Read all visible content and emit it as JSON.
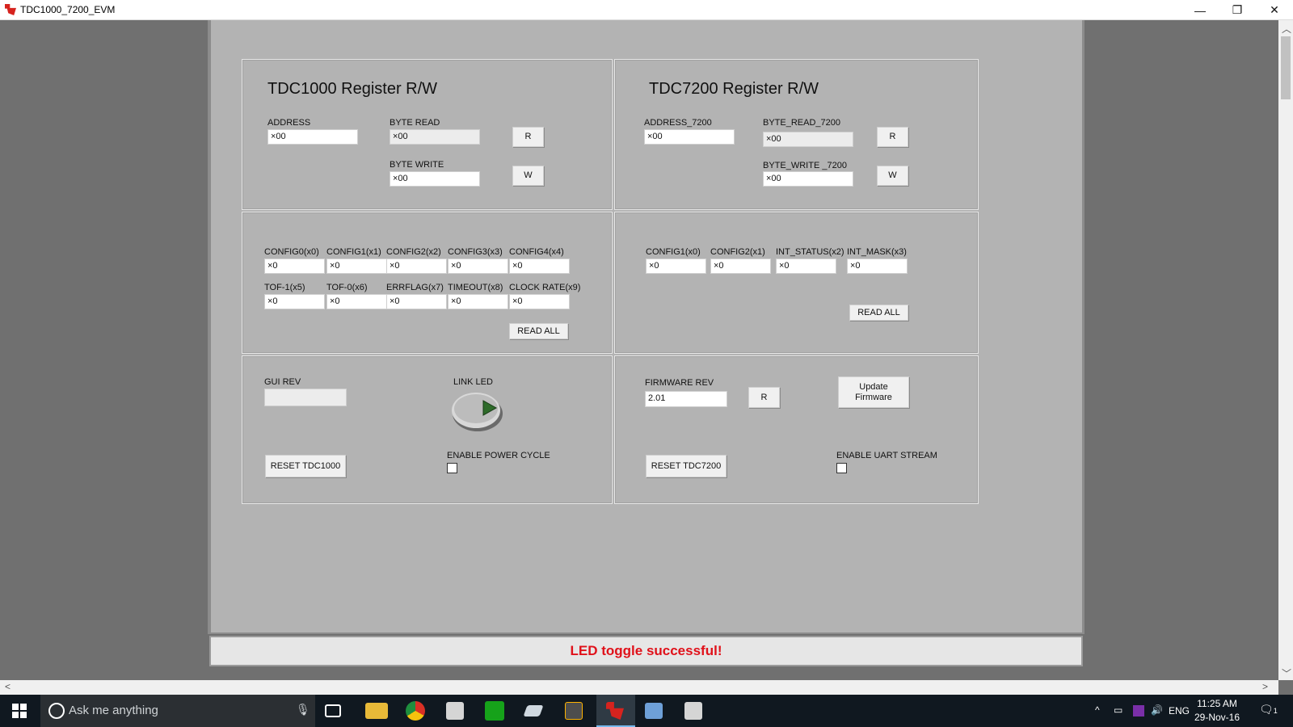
{
  "window": {
    "title": "TDC1000_7200_EVM",
    "minimize": "—",
    "restore": "❐",
    "close": "✕"
  },
  "tdc1000_rw": {
    "title": "TDC1000 Register R/W",
    "address_label": "ADDRESS",
    "address_value": "×00",
    "byte_read_label": "BYTE READ",
    "byte_read_value": "×00",
    "byte_write_label": "BYTE WRITE",
    "byte_write_value": "×00",
    "read_button": "R",
    "write_button": "W"
  },
  "tdc7200_rw": {
    "title": "TDC7200 Register R/W",
    "address_label": "ADDRESS_7200",
    "address_value": "×00",
    "byte_read_label": "BYTE_READ_7200",
    "byte_read_value": "×00",
    "byte_write_label": "BYTE_WRITE _7200",
    "byte_write_value": "×00",
    "read_button": "R",
    "write_button": "W"
  },
  "tdc1000_regs": {
    "row1": [
      {
        "label": "CONFIG0(x0)",
        "value": "×0"
      },
      {
        "label": "CONFIG1(x1)",
        "value": "×0"
      },
      {
        "label": "CONFIG2(x2)",
        "value": "×0"
      },
      {
        "label": "CONFIG3(x3)",
        "value": "×0"
      },
      {
        "label": "CONFIG4(x4)",
        "value": "×0"
      }
    ],
    "row2": [
      {
        "label": "TOF-1(x5)",
        "value": "×0"
      },
      {
        "label": "TOF-0(x6)",
        "value": "×0"
      },
      {
        "label": "ERRFLAG(x7)",
        "value": "×0"
      },
      {
        "label": "TIMEOUT(x8)",
        "value": "×0"
      },
      {
        "label": "CLOCK RATE(x9)",
        "value": "×0"
      }
    ],
    "read_all": "READ ALL"
  },
  "tdc7200_regs": {
    "row1": [
      {
        "label": "CONFIG1(x0)",
        "value": "×0"
      },
      {
        "label": "CONFIG2(x1)",
        "value": "×0"
      },
      {
        "label": "INT_STATUS(x2)",
        "value": "×0"
      },
      {
        "label": "INT_MASK(x3)",
        "value": "×0"
      }
    ],
    "read_all": "READ ALL"
  },
  "tdc1000_misc": {
    "gui_rev_label": "GUI REV",
    "gui_rev_value": "",
    "link_led_label": "LINK LED",
    "reset_button": "RESET TDC1000",
    "power_cycle_label": "ENABLE POWER CYCLE",
    "power_cycle_checked": false
  },
  "tdc7200_misc": {
    "firmware_rev_label": "FIRMWARE REV",
    "firmware_rev_value": "2.01",
    "read_button": "R",
    "update_firmware_line1": "Update",
    "update_firmware_line2": "Firmware",
    "reset_button": "RESET TDC7200",
    "uart_stream_label": "ENABLE UART STREAM",
    "uart_stream_checked": false
  },
  "status_message": "LED toggle successful!",
  "colors": {
    "status_text": "#e0111a",
    "panel": "#b3b3b3",
    "led": "#2e6b2a"
  },
  "taskbar": {
    "search_placeholder": "Ask me anything",
    "language": "ENG",
    "time": "11:25 AM",
    "date": "29-Nov-16",
    "notification_count": "1",
    "icons": [
      "task-view-icon",
      "file-explorer-icon",
      "chrome-icon",
      "cube-app-icon",
      "hsp-app-icon",
      "pen-app-icon",
      "sublime-icon",
      "ti-app-icon",
      "computer-app-icon",
      "cube-app-2-icon"
    ]
  }
}
